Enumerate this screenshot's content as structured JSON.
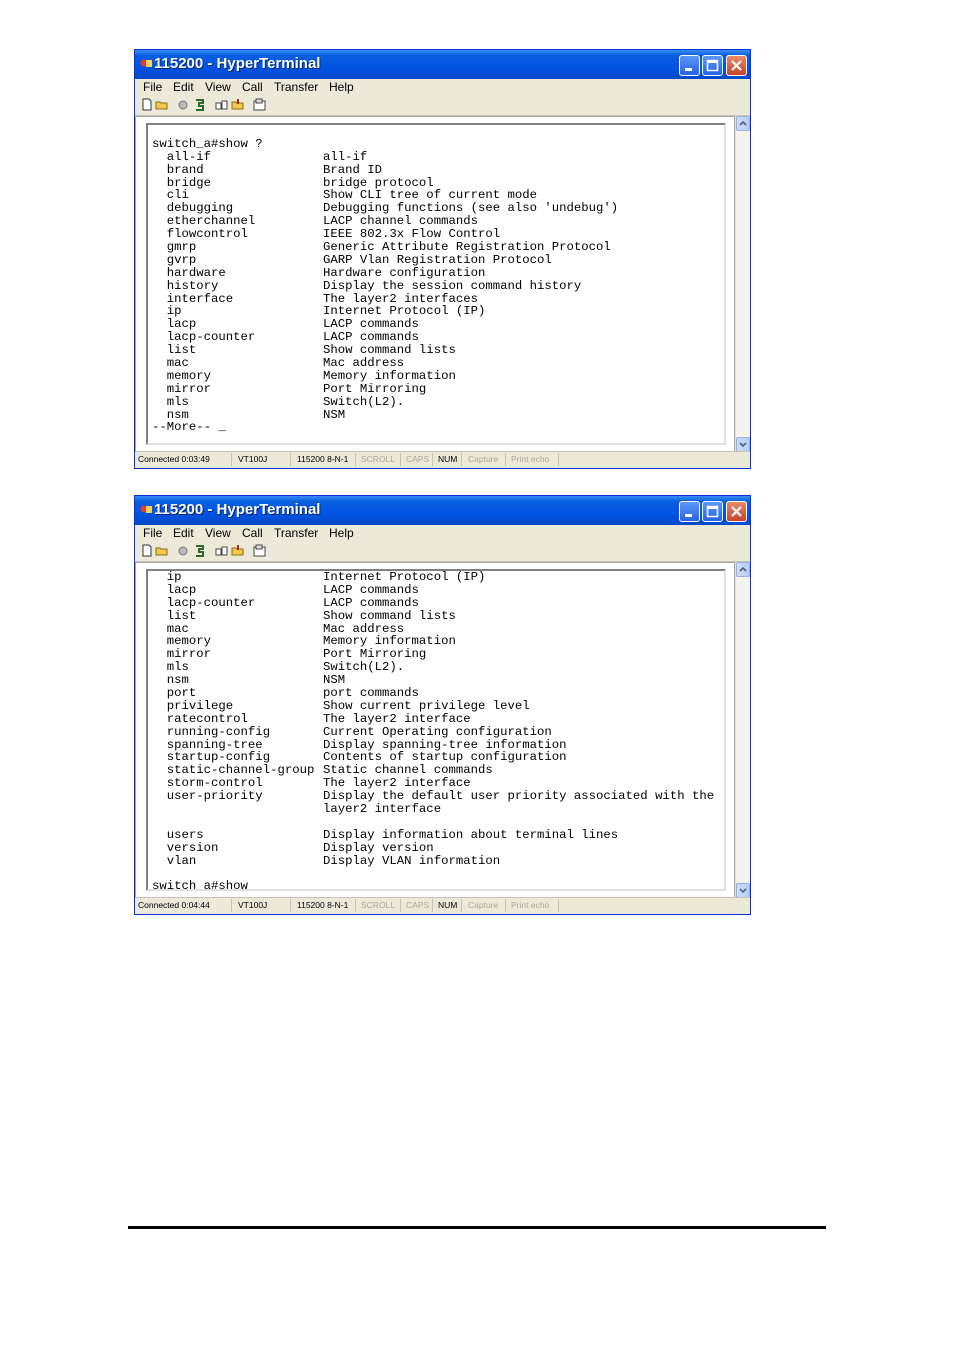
{
  "windows": [
    {
      "title": "115200 - HyperTerminal",
      "menu": [
        "File",
        "Edit",
        "View",
        "Call",
        "Transfer",
        "Help"
      ],
      "terminal_lines": [
        {
          "a": "",
          "b": ""
        },
        {
          "a": "switch_a#show ?",
          "b": ""
        },
        {
          "a": "  all-if",
          "b": "all-if"
        },
        {
          "a": "  brand",
          "b": "Brand ID"
        },
        {
          "a": "  bridge",
          "b": "bridge protocol"
        },
        {
          "a": "  cli",
          "b": "Show CLI tree of current mode"
        },
        {
          "a": "  debugging",
          "b": "Debugging functions (see also 'undebug')"
        },
        {
          "a": "  etherchannel",
          "b": "LACP channel commands"
        },
        {
          "a": "  flowcontrol",
          "b": "IEEE 802.3x Flow Control"
        },
        {
          "a": "  gmrp",
          "b": "Generic Attribute Registration Protocol"
        },
        {
          "a": "  gvrp",
          "b": "GARP Vlan Registration Protocol"
        },
        {
          "a": "  hardware",
          "b": "Hardware configuration"
        },
        {
          "a": "  history",
          "b": "Display the session command history"
        },
        {
          "a": "  interface",
          "b": "The layer2 interfaces"
        },
        {
          "a": "  ip",
          "b": "Internet Protocol (IP)"
        },
        {
          "a": "  lacp",
          "b": "LACP commands"
        },
        {
          "a": "  lacp-counter",
          "b": "LACP commands"
        },
        {
          "a": "  list",
          "b": "Show command lists"
        },
        {
          "a": "  mac",
          "b": "Mac address"
        },
        {
          "a": "  memory",
          "b": "Memory information"
        },
        {
          "a": "  mirror",
          "b": "Port Mirroring"
        },
        {
          "a": "  mls",
          "b": "Switch(L2)."
        },
        {
          "a": "  nsm",
          "b": "NSM"
        },
        {
          "a": "--More-- _",
          "b": ""
        }
      ],
      "status": {
        "connected": "Connected 0:03:49",
        "emulation": "VT100J",
        "port": "115200 8-N-1",
        "scroll": "SCROLL",
        "caps": "CAPS",
        "num": "NUM",
        "capture": "Capture",
        "print_echo": "Print echo"
      }
    },
    {
      "title": "115200 - HyperTerminal",
      "menu": [
        "File",
        "Edit",
        "View",
        "Call",
        "Transfer",
        "Help"
      ],
      "terminal_lines": [
        {
          "a": "  ip",
          "b": "Internet Protocol (IP)"
        },
        {
          "a": "  lacp",
          "b": "LACP commands"
        },
        {
          "a": "  lacp-counter",
          "b": "LACP commands"
        },
        {
          "a": "  list",
          "b": "Show command lists"
        },
        {
          "a": "  mac",
          "b": "Mac address"
        },
        {
          "a": "  memory",
          "b": "Memory information"
        },
        {
          "a": "  mirror",
          "b": "Port Mirroring"
        },
        {
          "a": "  mls",
          "b": "Switch(L2)."
        },
        {
          "a": "  nsm",
          "b": "NSM"
        },
        {
          "a": "  port",
          "b": "port commands"
        },
        {
          "a": "  privilege",
          "b": "Show current privilege level"
        },
        {
          "a": "  ratecontrol",
          "b": "The layer2 interface"
        },
        {
          "a": "  running-config",
          "b": "Current Operating configuration"
        },
        {
          "a": "  spanning-tree",
          "b": "Display spanning-tree information"
        },
        {
          "a": "  startup-config",
          "b": "Contents of startup configuration"
        },
        {
          "a": "  static-channel-group",
          "b": "Static channel commands"
        },
        {
          "a": "  storm-control",
          "b": "The layer2 interface"
        },
        {
          "a": "  user-priority",
          "b": "Display the default user priority associated with the"
        },
        {
          "a": "",
          "b": "layer2 interface"
        },
        {
          "a": "",
          "b": ""
        },
        {
          "a": "  users",
          "b": "Display information about terminal lines"
        },
        {
          "a": "  version",
          "b": "Display version"
        },
        {
          "a": "  vlan",
          "b": "Display VLAN information"
        },
        {
          "a": "",
          "b": ""
        },
        {
          "a": "switch_a#show _",
          "b": ""
        }
      ],
      "status": {
        "connected": "Connected 0:04:44",
        "emulation": "VT100J",
        "port": "115200 8-N-1",
        "scroll": "SCROLL",
        "caps": "CAPS",
        "num": "NUM",
        "capture": "Capture",
        "print_echo": "Print echo"
      }
    }
  ],
  "icons": [
    "app-icon",
    "new-icon",
    "open-icon",
    "disconnect-icon",
    "dial-icon",
    "send-icon",
    "receive-icon",
    "properties-icon"
  ]
}
